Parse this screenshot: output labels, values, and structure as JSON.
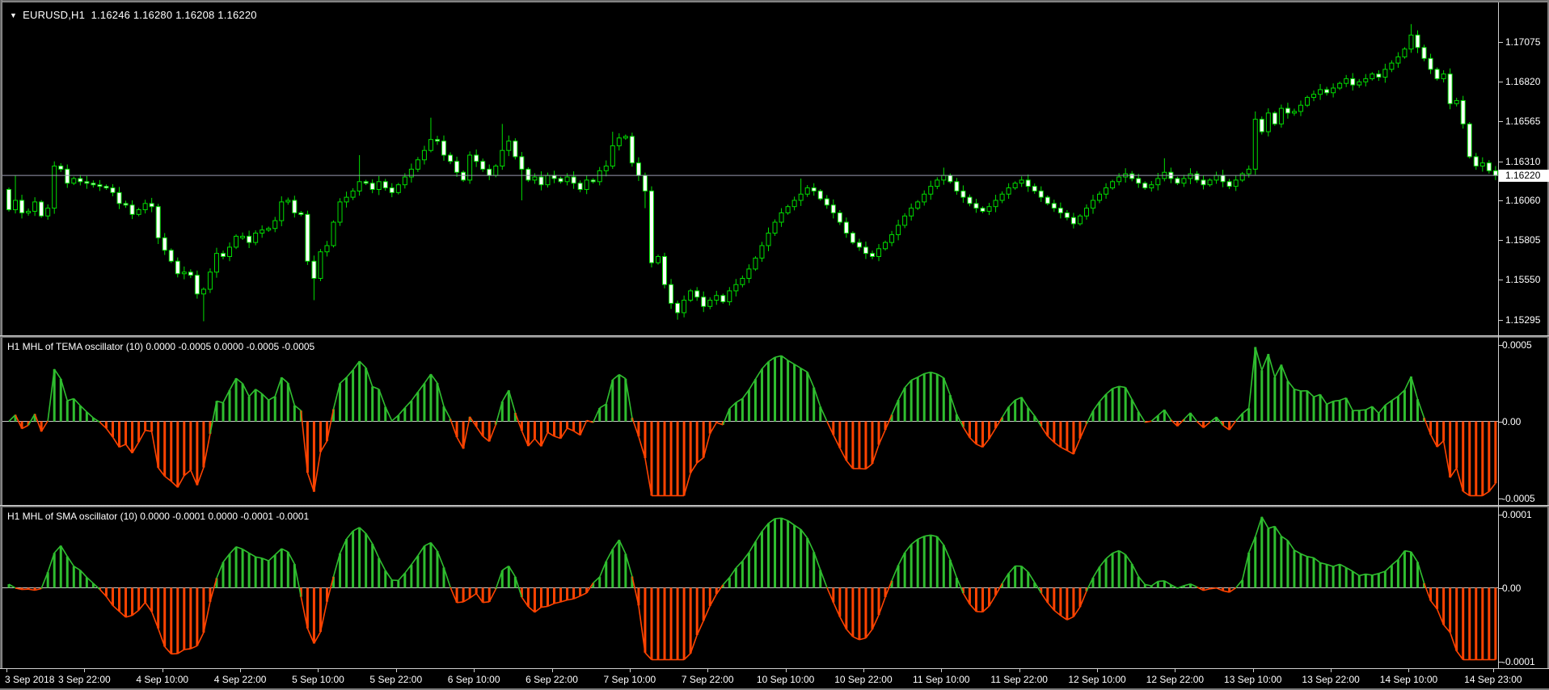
{
  "window": {
    "collapse_icon": "▼",
    "symbol": "EURUSD,H1",
    "ohlc_text": "1.16246 1.16280 1.16208 1.16220"
  },
  "colors": {
    "background": "#000000",
    "candle_outline": "#00DE00",
    "bull_fill": "#000000",
    "bear_fill": "#FFFFFF",
    "osc_green": "#2FBE2F",
    "osc_red": "#FF4300",
    "zero_line": "#C8C8C8",
    "axis_text": "#FFFFFF",
    "current_price_line": "#9A9AB0",
    "price_box_bg": "#FFFFFF",
    "price_box_text": "#000000"
  },
  "price_axis": {
    "labels": [
      "1.17075",
      "1.16820",
      "1.16565",
      "1.16310",
      "1.16060",
      "1.15805",
      "1.15550",
      "1.15295"
    ],
    "values": [
      1.17075,
      1.1682,
      1.16565,
      1.1631,
      1.1606,
      1.15805,
      1.1555,
      1.15295
    ],
    "current_label": "1.16220",
    "current_value": 1.1622
  },
  "time_axis": [
    {
      "text": "3 Sep 2018",
      "bar": 0
    },
    {
      "text": "3 Sep 22:00",
      "bar": 12
    },
    {
      "text": "4 Sep 10:00",
      "bar": 24
    },
    {
      "text": "4 Sep 22:00",
      "bar": 36
    },
    {
      "text": "5 Sep 10:00",
      "bar": 48
    },
    {
      "text": "5 Sep 22:00",
      "bar": 60
    },
    {
      "text": "6 Sep 10:00",
      "bar": 72
    },
    {
      "text": "6 Sep 22:00",
      "bar": 84
    },
    {
      "text": "7 Sep 10:00",
      "bar": 96
    },
    {
      "text": "7 Sep 22:00",
      "bar": 108
    },
    {
      "text": "10 Sep 10:00",
      "bar": 120
    },
    {
      "text": "10 Sep 22:00",
      "bar": 132
    },
    {
      "text": "11 Sep 10:00",
      "bar": 144
    },
    {
      "text": "11 Sep 22:00",
      "bar": 156
    },
    {
      "text": "12 Sep 10:00",
      "bar": 168
    },
    {
      "text": "12 Sep 22:00",
      "bar": 180
    },
    {
      "text": "13 Sep 10:00",
      "bar": 192
    },
    {
      "text": "13 Sep 22:00",
      "bar": 204
    },
    {
      "text": "14 Sep 10:00",
      "bar": 216
    },
    {
      "text": "14 Sep 23:00",
      "bar": 229
    }
  ],
  "chart_data": [
    {
      "id": "price",
      "type": "candlestick",
      "title": "EURUSD,H1  1.16246 1.16280 1.16208 1.16220",
      "ylim": [
        1.15196,
        1.17329
      ],
      "open_first": 1.1613,
      "closes": [
        1.16,
        1.1606,
        1.1598,
        1.1599,
        1.1605,
        1.1596,
        1.1601,
        1.1628,
        1.1626,
        1.1617,
        1.162,
        1.1618,
        1.1617,
        1.1616,
        1.1615,
        1.1614,
        1.1611,
        1.1604,
        1.1603,
        1.1597,
        1.16,
        1.1604,
        1.1602,
        1.1582,
        1.1574,
        1.1567,
        1.1559,
        1.156,
        1.1558,
        1.1546,
        1.1549,
        1.156,
        1.1572,
        1.157,
        1.1576,
        1.1583,
        1.1583,
        1.1579,
        1.1585,
        1.1587,
        1.1588,
        1.1593,
        1.1605,
        1.1606,
        1.1598,
        1.1597,
        1.1567,
        1.1556,
        1.1573,
        1.1577,
        1.1592,
        1.1605,
        1.1608,
        1.1612,
        1.1618,
        1.1617,
        1.1613,
        1.1618,
        1.1614,
        1.1611,
        1.1616,
        1.1621,
        1.1626,
        1.1632,
        1.1638,
        1.1645,
        1.1644,
        1.1635,
        1.1631,
        1.1624,
        1.1619,
        1.1635,
        1.1631,
        1.1626,
        1.1622,
        1.1628,
        1.1638,
        1.1644,
        1.1634,
        1.1626,
        1.1619,
        1.1621,
        1.1616,
        1.1622,
        1.162,
        1.1618,
        1.1621,
        1.1617,
        1.1613,
        1.1619,
        1.1618,
        1.1625,
        1.1628,
        1.1641,
        1.1646,
        1.1647,
        1.163,
        1.1622,
        1.1612,
        1.1566,
        1.157,
        1.1552,
        1.154,
        1.1534,
        1.1542,
        1.1548,
        1.1544,
        1.1538,
        1.1542,
        1.1545,
        1.1541,
        1.1548,
        1.1552,
        1.1556,
        1.1562,
        1.1569,
        1.1577,
        1.1585,
        1.1592,
        1.1598,
        1.1602,
        1.1606,
        1.161,
        1.1614,
        1.1612,
        1.1607,
        1.1603,
        1.1598,
        1.1592,
        1.1585,
        1.1579,
        1.1576,
        1.1572,
        1.157,
        1.1575,
        1.1579,
        1.1584,
        1.159,
        1.1596,
        1.1601,
        1.1605,
        1.161,
        1.1615,
        1.1619,
        1.1622,
        1.1618,
        1.1612,
        1.1608,
        1.1604,
        1.1601,
        1.1599,
        1.1602,
        1.1606,
        1.161,
        1.1614,
        1.1617,
        1.1619,
        1.1615,
        1.1612,
        1.1608,
        1.1604,
        1.1601,
        1.1598,
        1.1595,
        1.1591,
        1.1596,
        1.1601,
        1.1606,
        1.161,
        1.1614,
        1.1618,
        1.1621,
        1.1623,
        1.162,
        1.1617,
        1.1614,
        1.1616,
        1.162,
        1.1624,
        1.162,
        1.1617,
        1.162,
        1.1623,
        1.1619,
        1.1616,
        1.1619,
        1.1622,
        1.1618,
        1.1615,
        1.1619,
        1.1623,
        1.1626,
        1.1658,
        1.165,
        1.1662,
        1.1655,
        1.1665,
        1.1662,
        1.1663,
        1.1667,
        1.1672,
        1.1674,
        1.1677,
        1.1675,
        1.1678,
        1.1681,
        1.1684,
        1.168,
        1.1682,
        1.1684,
        1.1687,
        1.1685,
        1.169,
        1.1694,
        1.1698,
        1.1703,
        1.1712,
        1.1704,
        1.1697,
        1.169,
        1.1684,
        1.1687,
        1.1668,
        1.167,
        1.1655,
        1.1634,
        1.1628,
        1.163,
        1.1625,
        1.1622
      ],
      "wick_overrides": {
        "1": {
          "h": 1.1622
        },
        "7": {
          "h": 1.1631
        },
        "23": {
          "l": 1.1578
        },
        "30": {
          "l": 1.15285
        },
        "47": {
          "l": 1.1542
        },
        "54": {
          "h": 1.1635
        },
        "65": {
          "h": 1.1659
        },
        "76": {
          "h": 1.1655
        },
        "79": {
          "l": 1.1606
        },
        "93": {
          "h": 1.165
        },
        "98": {
          "l": 1.1601
        },
        "103": {
          "l": 1.15295
        },
        "122": {
          "h": 1.162
        },
        "144": {
          "h": 1.1627
        },
        "178": {
          "h": 1.1633
        },
        "192": {
          "h": 1.1663
        },
        "216": {
          "h": 1.1719
        },
        "217": {
          "h": 1.1715
        }
      }
    },
    {
      "id": "tema_osc",
      "type": "histogram",
      "title": "H1 MHL of TEMA oscillator (10) 0.0000 -0.0005 0.0000 -0.0005 -0.0005",
      "scale_labels": {
        "top": "0.0005",
        "zero": "0.00",
        "bottom": "-0.0005"
      },
      "ylim": [
        -0.0005,
        0.0005
      ],
      "derived_from": "price.closes",
      "formula": "close - SMA10(close), clamped",
      "clamp": 0.0034,
      "smooth": 1
    },
    {
      "id": "sma_osc",
      "type": "histogram",
      "title": "H1 MHL of SMA oscillator (10) 0.0000 -0.0001 0.0000 -0.0001 -0.0001",
      "scale_labels": {
        "top": "0.0001",
        "zero": "0.00",
        "bottom": "-0.0001"
      },
      "ylim": [
        -0.0001,
        0.0001
      ],
      "derived_from": "price.closes",
      "formula": "smoothed(close - SMA10(close)), clamped",
      "clamp": 0.003,
      "smooth": 3
    }
  ]
}
